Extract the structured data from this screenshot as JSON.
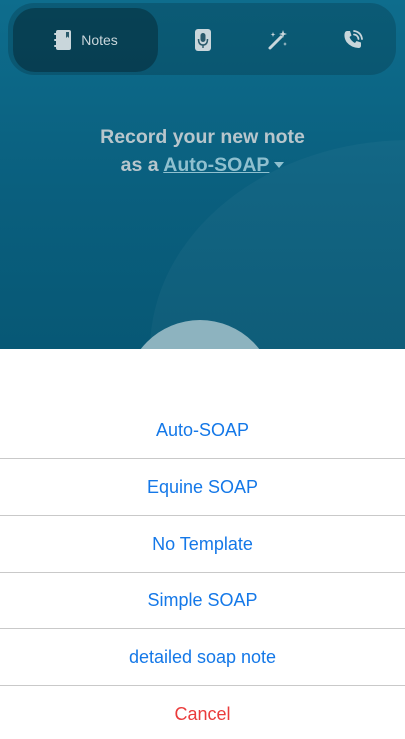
{
  "nav": {
    "tabs": [
      {
        "label": "Notes",
        "icon": "notebook-icon",
        "active": true
      },
      {
        "icon": "microphone-icon",
        "active": false
      },
      {
        "icon": "magic-wand-icon",
        "active": false
      },
      {
        "icon": "phone-call-icon",
        "active": false
      }
    ]
  },
  "main": {
    "headline_line1": "Record your new note",
    "headline_prefix": "as a",
    "template_name": "Auto-SOAP"
  },
  "sheet": {
    "options": [
      "Auto-SOAP",
      "Equine SOAP",
      "No Template",
      "Simple SOAP",
      "detailed soap note"
    ],
    "cancel_label": "Cancel"
  },
  "colors": {
    "background": "#0a6484",
    "link": "#1478e8",
    "cancel": "#ea3b3b"
  }
}
